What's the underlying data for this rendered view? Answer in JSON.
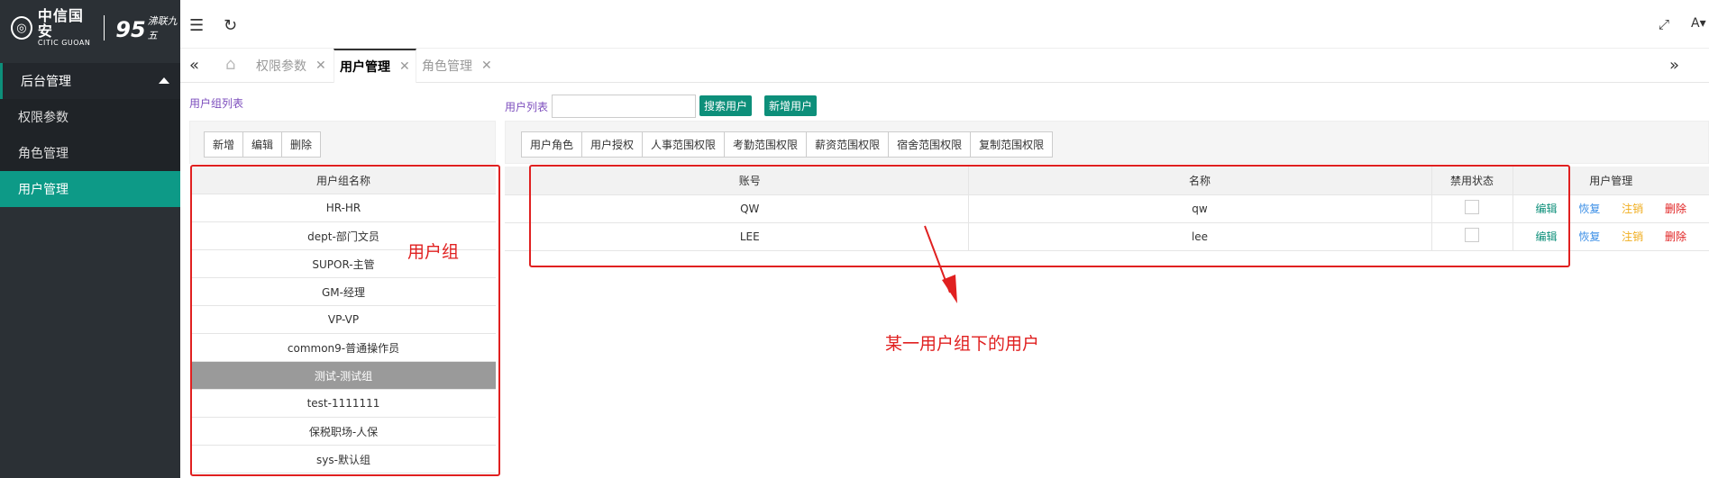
{
  "logo": {
    "name": "中信国安",
    "name_en": "CITIC GUOAN",
    "brand2_mark": "95",
    "brand2_sub": "沸联九五"
  },
  "sidebar": {
    "group_label": "后台管理",
    "items": [
      {
        "label": "权限参数",
        "active": false
      },
      {
        "label": "角色管理",
        "active": false
      },
      {
        "label": "用户管理",
        "active": true
      }
    ]
  },
  "header": {
    "font_size_label": "A"
  },
  "tabs": [
    {
      "label": "权限参数",
      "active": false
    },
    {
      "label": "用户管理",
      "active": true
    },
    {
      "label": "角色管理",
      "active": false
    }
  ],
  "group_panel": {
    "title": "用户组列表",
    "buttons": [
      "新增",
      "编辑",
      "删除"
    ],
    "column_header": "用户组名称",
    "groups": [
      "HR-HR",
      "dept-部门文员",
      "SUPOR-主管",
      "GM-经理",
      "VP-VP",
      "common9-普通操作员",
      "测试-测试组",
      "test-1111111",
      "保税职场-人保",
      "sys-默认组"
    ],
    "selected_index": 6
  },
  "user_panel": {
    "title": "用户列表",
    "search_value": "",
    "search_button": "搜索用户",
    "add_button": "新增用户",
    "buttons": [
      "用户角色",
      "用户授权",
      "人事范围权限",
      "考勤范围权限",
      "薪资范围权限",
      "宿舍范围权限",
      "复制范围权限"
    ],
    "columns": [
      "账号",
      "名称",
      "禁用状态",
      "用户管理"
    ],
    "rows": [
      {
        "account": "QW",
        "name": "qw",
        "disabled": false
      },
      {
        "account": "LEE",
        "name": "lee",
        "disabled": false
      }
    ],
    "actions": [
      {
        "label": "编辑",
        "color": "#0d8f7a"
      },
      {
        "label": "恢复",
        "color": "#3a8ee6"
      },
      {
        "label": "注销",
        "color": "#f0ad1e"
      },
      {
        "label": "删除",
        "color": "#e02020"
      }
    ]
  },
  "annotations": {
    "group_label": "用户组",
    "users_label": "某一用户组下的用户",
    "color": "#e02020"
  }
}
